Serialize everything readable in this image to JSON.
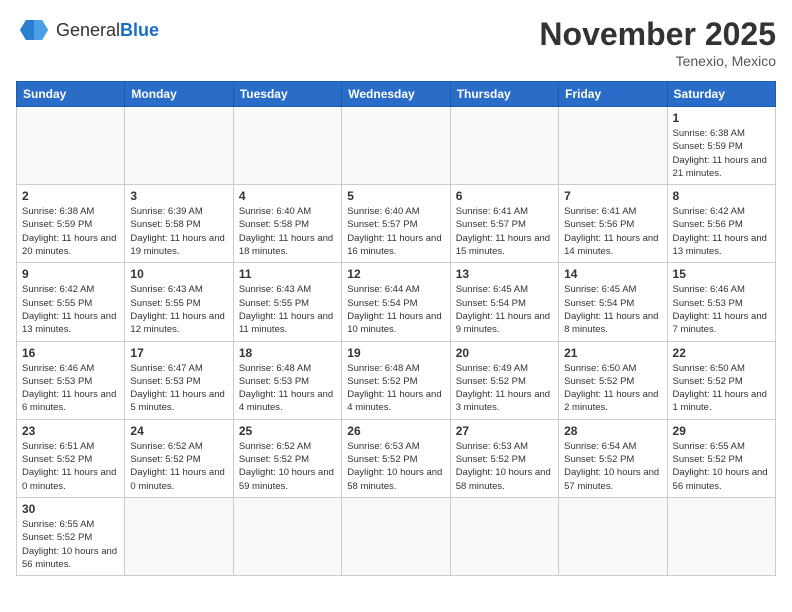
{
  "header": {
    "logo_general": "General",
    "logo_blue": "Blue",
    "month_title": "November 2025",
    "location": "Tenexio, Mexico"
  },
  "days_of_week": [
    "Sunday",
    "Monday",
    "Tuesday",
    "Wednesday",
    "Thursday",
    "Friday",
    "Saturday"
  ],
  "weeks": [
    [
      {
        "day": "",
        "info": ""
      },
      {
        "day": "",
        "info": ""
      },
      {
        "day": "",
        "info": ""
      },
      {
        "day": "",
        "info": ""
      },
      {
        "day": "",
        "info": ""
      },
      {
        "day": "",
        "info": ""
      },
      {
        "day": "1",
        "info": "Sunrise: 6:38 AM\nSunset: 5:59 PM\nDaylight: 11 hours and 21 minutes."
      }
    ],
    [
      {
        "day": "2",
        "info": "Sunrise: 6:38 AM\nSunset: 5:59 PM\nDaylight: 11 hours and 20 minutes."
      },
      {
        "day": "3",
        "info": "Sunrise: 6:39 AM\nSunset: 5:58 PM\nDaylight: 11 hours and 19 minutes."
      },
      {
        "day": "4",
        "info": "Sunrise: 6:40 AM\nSunset: 5:58 PM\nDaylight: 11 hours and 18 minutes."
      },
      {
        "day": "5",
        "info": "Sunrise: 6:40 AM\nSunset: 5:57 PM\nDaylight: 11 hours and 16 minutes."
      },
      {
        "day": "6",
        "info": "Sunrise: 6:41 AM\nSunset: 5:57 PM\nDaylight: 11 hours and 15 minutes."
      },
      {
        "day": "7",
        "info": "Sunrise: 6:41 AM\nSunset: 5:56 PM\nDaylight: 11 hours and 14 minutes."
      },
      {
        "day": "8",
        "info": "Sunrise: 6:42 AM\nSunset: 5:56 PM\nDaylight: 11 hours and 13 minutes."
      }
    ],
    [
      {
        "day": "9",
        "info": "Sunrise: 6:42 AM\nSunset: 5:55 PM\nDaylight: 11 hours and 13 minutes."
      },
      {
        "day": "10",
        "info": "Sunrise: 6:43 AM\nSunset: 5:55 PM\nDaylight: 11 hours and 12 minutes."
      },
      {
        "day": "11",
        "info": "Sunrise: 6:43 AM\nSunset: 5:55 PM\nDaylight: 11 hours and 11 minutes."
      },
      {
        "day": "12",
        "info": "Sunrise: 6:44 AM\nSunset: 5:54 PM\nDaylight: 11 hours and 10 minutes."
      },
      {
        "day": "13",
        "info": "Sunrise: 6:45 AM\nSunset: 5:54 PM\nDaylight: 11 hours and 9 minutes."
      },
      {
        "day": "14",
        "info": "Sunrise: 6:45 AM\nSunset: 5:54 PM\nDaylight: 11 hours and 8 minutes."
      },
      {
        "day": "15",
        "info": "Sunrise: 6:46 AM\nSunset: 5:53 PM\nDaylight: 11 hours and 7 minutes."
      }
    ],
    [
      {
        "day": "16",
        "info": "Sunrise: 6:46 AM\nSunset: 5:53 PM\nDaylight: 11 hours and 6 minutes."
      },
      {
        "day": "17",
        "info": "Sunrise: 6:47 AM\nSunset: 5:53 PM\nDaylight: 11 hours and 5 minutes."
      },
      {
        "day": "18",
        "info": "Sunrise: 6:48 AM\nSunset: 5:53 PM\nDaylight: 11 hours and 4 minutes."
      },
      {
        "day": "19",
        "info": "Sunrise: 6:48 AM\nSunset: 5:52 PM\nDaylight: 11 hours and 4 minutes."
      },
      {
        "day": "20",
        "info": "Sunrise: 6:49 AM\nSunset: 5:52 PM\nDaylight: 11 hours and 3 minutes."
      },
      {
        "day": "21",
        "info": "Sunrise: 6:50 AM\nSunset: 5:52 PM\nDaylight: 11 hours and 2 minutes."
      },
      {
        "day": "22",
        "info": "Sunrise: 6:50 AM\nSunset: 5:52 PM\nDaylight: 11 hours and 1 minute."
      }
    ],
    [
      {
        "day": "23",
        "info": "Sunrise: 6:51 AM\nSunset: 5:52 PM\nDaylight: 11 hours and 0 minutes."
      },
      {
        "day": "24",
        "info": "Sunrise: 6:52 AM\nSunset: 5:52 PM\nDaylight: 11 hours and 0 minutes."
      },
      {
        "day": "25",
        "info": "Sunrise: 6:52 AM\nSunset: 5:52 PM\nDaylight: 10 hours and 59 minutes."
      },
      {
        "day": "26",
        "info": "Sunrise: 6:53 AM\nSunset: 5:52 PM\nDaylight: 10 hours and 58 minutes."
      },
      {
        "day": "27",
        "info": "Sunrise: 6:53 AM\nSunset: 5:52 PM\nDaylight: 10 hours and 58 minutes."
      },
      {
        "day": "28",
        "info": "Sunrise: 6:54 AM\nSunset: 5:52 PM\nDaylight: 10 hours and 57 minutes."
      },
      {
        "day": "29",
        "info": "Sunrise: 6:55 AM\nSunset: 5:52 PM\nDaylight: 10 hours and 56 minutes."
      }
    ],
    [
      {
        "day": "30",
        "info": "Sunrise: 6:55 AM\nSunset: 5:52 PM\nDaylight: 10 hours and 56 minutes."
      },
      {
        "day": "",
        "info": ""
      },
      {
        "day": "",
        "info": ""
      },
      {
        "day": "",
        "info": ""
      },
      {
        "day": "",
        "info": ""
      },
      {
        "day": "",
        "info": ""
      },
      {
        "day": "",
        "info": ""
      }
    ]
  ]
}
